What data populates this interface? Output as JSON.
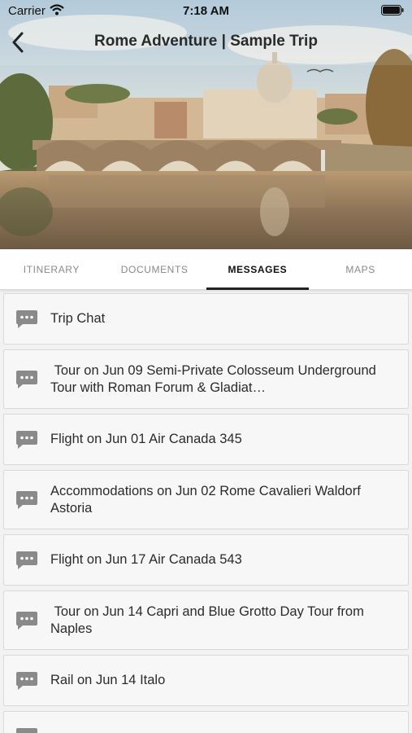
{
  "status_bar": {
    "carrier": "Carrier",
    "time": "7:18 AM"
  },
  "header": {
    "title": "Rome Adventure | Sample Trip"
  },
  "tabs": [
    {
      "label": "ITINERARY",
      "active": false
    },
    {
      "label": "DOCUMENTS",
      "active": false
    },
    {
      "label": "MESSAGES",
      "active": true
    },
    {
      "label": "MAPS",
      "active": false
    }
  ],
  "messages": [
    {
      "text": "Trip Chat"
    },
    {
      "text": " Tour on Jun 09 Semi-Private Colosseum Underground Tour with Roman Forum & Gladiat…"
    },
    {
      "text": "Flight on Jun 01 Air Canada 345"
    },
    {
      "text": "Accommodations on Jun 02 Rome Cavalieri Waldorf Astoria"
    },
    {
      "text": "Flight on Jun 17 Air Canada 543"
    },
    {
      "text": " Tour on Jun 14 Capri and Blue Grotto Day Tour from Naples"
    },
    {
      "text": "Rail on Jun 14 Italo"
    },
    {
      "text": ""
    }
  ],
  "colors": {
    "icon": "#8a8a8a",
    "active_tab": "#222222",
    "card_bg": "#f7f7f7"
  },
  "icons": {
    "back": "chevron-left",
    "chat": "message-bubble",
    "wifi": "wifi",
    "battery": "battery"
  }
}
